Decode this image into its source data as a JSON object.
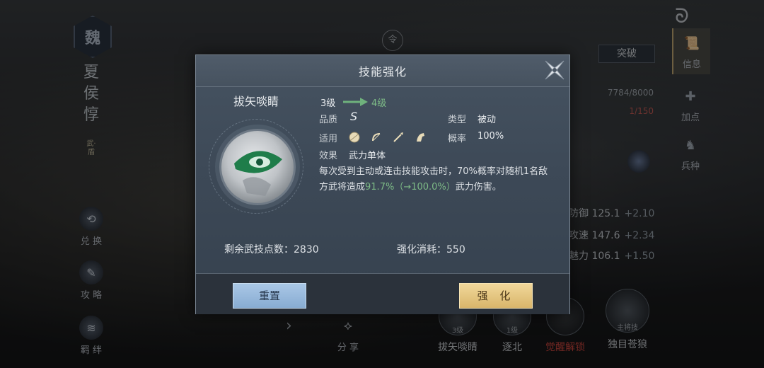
{
  "background": {
    "hero": {
      "faction": "魏",
      "name": "夏侯惇",
      "role": "武·盾"
    },
    "left_menu": [
      {
        "label": "兑 换",
        "icon": "exchange-icon"
      },
      {
        "label": "攻 略",
        "icon": "guide-icon"
      },
      {
        "label": "羁 绊",
        "icon": "bond-icon"
      }
    ],
    "top_center_icon": "令",
    "breakthrough_label": "突破",
    "right_menu": [
      {
        "label": "信息",
        "icon": "scroll-icon"
      },
      {
        "label": "加点",
        "icon": "add-point-icon"
      },
      {
        "label": "兵种",
        "icon": "troop-icon"
      }
    ],
    "exp_text": "7784/8000",
    "level_text": "1/150",
    "stats": [
      {
        "name": "防御",
        "value": "125.1",
        "delta": "+2.10"
      },
      {
        "name": "攻速",
        "value": "147.6",
        "delta": "+2.34"
      },
      {
        "name": "魅力",
        "value": "106.1",
        "delta": "+1.50"
      }
    ],
    "share_label": "分 享",
    "skills": [
      {
        "name": "拔矢啖睛",
        "badge": "3级"
      },
      {
        "name": "逐北",
        "badge": "1级"
      },
      {
        "name": "觉醒解锁",
        "badge": ""
      },
      {
        "name": "独目苍狼",
        "badge": "主将技"
      }
    ],
    "colors": {
      "unlock_red": "#d2473f",
      "accent_gold": "#c5ab76"
    }
  },
  "dialog": {
    "title": "技能强化",
    "skill_name": "拔矢啖睛",
    "level_from": "3级",
    "level_to": "4级",
    "quality_label": "品质",
    "quality_value": "S",
    "type_label": "类型",
    "type_value": "被动",
    "apply_label": "适用",
    "apply_icons": [
      "shield-icon",
      "bow-icon",
      "spear-icon",
      "horse-icon"
    ],
    "rate_label": "概率",
    "rate_value": "100%",
    "effect_label": "效果",
    "effect_value": "武力单体",
    "desc_part1": "每次受到主动或连击技能攻击时，70%概率对随机1名敌方武将造成",
    "desc_highlight": "91.7%（→100.0%）",
    "desc_part2": "武力伤害。",
    "remaining_points": "剩余武技点数：2830",
    "cost": "强化消耗：550",
    "reset_button": "重置",
    "enhance_button": "强 化",
    "colors": {
      "highlight_green": "#7dba86",
      "reset_blue": "#9bbbe0",
      "enhance_gold": "#e5c580"
    }
  }
}
